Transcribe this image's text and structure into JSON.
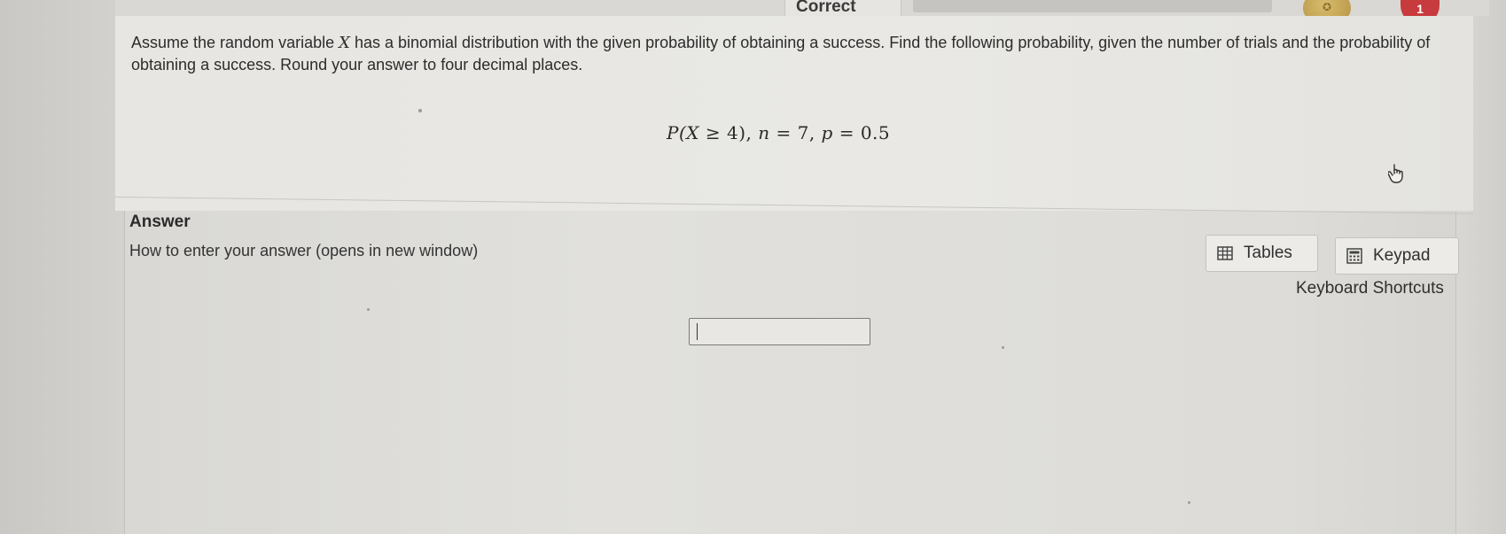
{
  "header": {
    "status_label": "Correct",
    "alert_count": "1"
  },
  "question": {
    "text_before_var": "Assume the random variable ",
    "var": "X",
    "text_after_var": " has a binomial distribution with the given probability of obtaining a success. Find the following probability, given the number of trials and the probability of obtaining a success. Round your answer to four decimal places.",
    "formula": {
      "p_open": "P(",
      "var": "X",
      "rel": " ≥ 4), ",
      "n_var": "n",
      "n_eq": " = 7, ",
      "p_var": "p",
      "p_eq": " = 0.5"
    }
  },
  "answer": {
    "heading": "Answer",
    "how_to_link": "How to enter your answer (opens in new window)",
    "tables_label": "Tables",
    "keypad_label": "Keypad",
    "shortcuts_label": "Keyboard Shortcuts",
    "input_value": ""
  },
  "icons": {
    "tables": "table-icon",
    "keypad": "calculator-icon",
    "cursor": "hand-pointer-icon",
    "coin": "coin-icon"
  },
  "colors": {
    "alert_badge": "#c73a3d",
    "coin": "#c6a655"
  }
}
